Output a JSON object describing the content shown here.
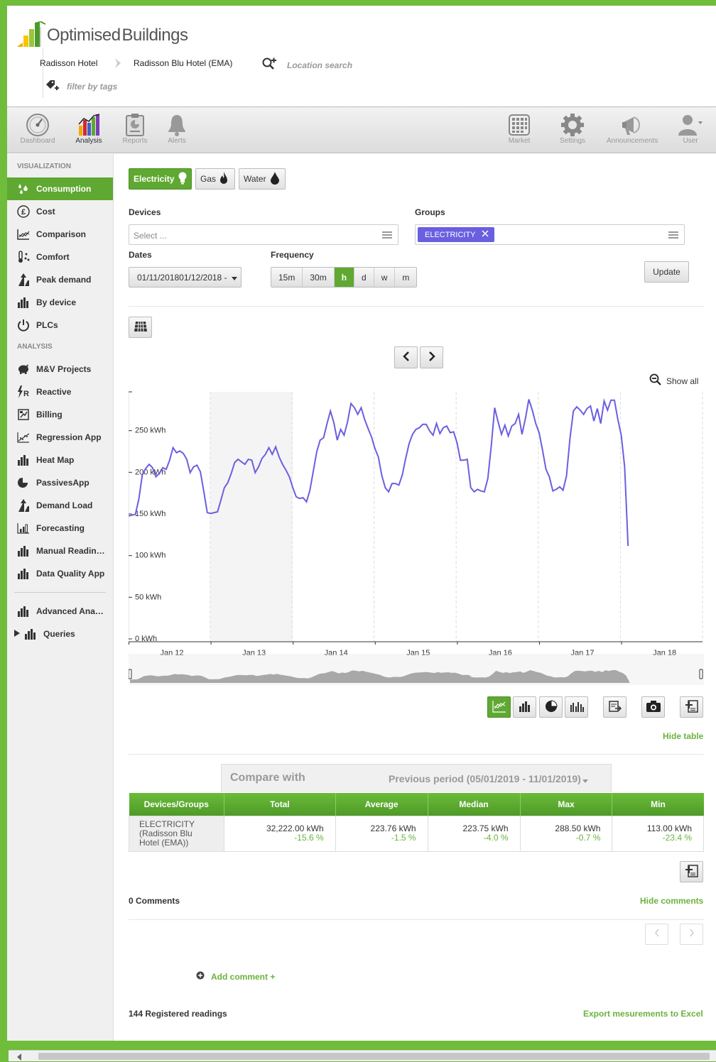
{
  "header": {
    "brand_first": "Optimised",
    "brand_second": "Buildings",
    "breadcrumb": [
      "Radisson Hotel",
      "Radisson Blu Hotel (EMA)"
    ],
    "search_placeholder": "Location search",
    "tags_placeholder": "filter by tags"
  },
  "toolbar": {
    "left": [
      {
        "label": "Dashboard",
        "icon": "speedometer-icon"
      },
      {
        "label": "Analysis",
        "icon": "bar-chart-icon"
      },
      {
        "label": "Reports",
        "icon": "report-icon"
      },
      {
        "label": "Alerts",
        "icon": "bell-icon"
      }
    ],
    "right": [
      {
        "label": "Market",
        "icon": "grid-icon"
      },
      {
        "label": "Settings",
        "icon": "gear-icon"
      },
      {
        "label": "Announcements",
        "icon": "megaphone-icon"
      },
      {
        "label": "User",
        "icon": "user-icon"
      }
    ]
  },
  "sidebar": {
    "visualization_title": "VISUALIZATION",
    "visualization": [
      "Consumption",
      "Cost",
      "Comparison",
      "Comfort",
      "Peak demand",
      "By device",
      "PLCs"
    ],
    "analysis_title": "ANALYSIS",
    "analysis": [
      "M&V Projects",
      "Reactive",
      "Billing",
      "Regression App",
      "Heat Map",
      "PassivesApp",
      "Demand Load",
      "Forecasting",
      "Manual Readin…",
      "Data Quality App"
    ],
    "extra": [
      "Advanced Ana…",
      "Queries"
    ]
  },
  "filters": {
    "utilities": [
      "Electricity",
      "Gas",
      "Water"
    ],
    "devices_label": "Devices",
    "devices_placeholder": "Select ...",
    "groups_label": "Groups",
    "groups_chip": "ELECTRICITY",
    "dates_label": "Dates",
    "dates_value": "01/11/201801/12/2018 -",
    "frequency_label": "Frequency",
    "frequency_options": [
      "15m",
      "30m",
      "h",
      "d",
      "w",
      "m"
    ],
    "frequency_selected": "h",
    "update_label": "Update"
  },
  "show_all_label": "Show all",
  "chart_data": {
    "type": "line",
    "ylabel": "",
    "yunit": "kWh",
    "ylim": [
      0,
      300
    ],
    "yticks": [
      "0 kWh",
      "50 kWh",
      "100 kWh",
      "150 kWh",
      "200 kWh",
      "250 kWh"
    ],
    "xticks": [
      "Jan 12",
      "Jan 13",
      "Jan 14",
      "Jan 15",
      "Jan 16",
      "Jan 17",
      "Jan 18"
    ],
    "x_start_label": "Jan 12",
    "line_color": "#6a5fe0",
    "values": [
      151,
      152,
      153,
      171,
      200,
      208,
      213,
      209,
      198,
      202,
      209,
      207,
      218,
      233,
      227,
      229,
      226,
      219,
      203,
      210,
      212,
      204,
      180,
      155,
      154,
      155,
      156,
      170,
      185,
      191,
      202,
      215,
      219,
      216,
      213,
      219,
      218,
      203,
      210,
      220,
      225,
      233,
      225,
      234,
      222,
      213,
      206,
      198,
      185,
      174,
      172,
      173,
      168,
      182,
      205,
      228,
      242,
      245,
      262,
      277,
      263,
      242,
      255,
      248,
      264,
      286,
      281,
      273,
      281,
      267,
      256,
      246,
      232,
      222,
      200,
      185,
      180,
      190,
      190,
      188,
      200,
      220,
      238,
      249,
      255,
      257,
      261,
      261,
      253,
      248,
      262,
      250,
      257,
      259,
      251,
      252,
      239,
      218,
      218,
      219,
      185,
      180,
      183,
      181,
      180,
      196,
      235,
      281,
      264,
      249,
      260,
      247,
      259,
      262,
      273,
      249,
      268,
      291,
      278,
      262,
      251,
      230,
      207,
      198,
      181,
      183,
      186,
      182,
      199,
      244,
      277,
      282,
      278,
      273,
      280,
      283,
      265,
      280,
      262,
      289,
      278,
      290,
      290,
      267,
      248,
      210,
      115
    ]
  },
  "chart_tools": [
    "line-chart-icon",
    "bar-chart-icon",
    "pie-chart-icon",
    "grouped-bar-icon",
    "export-icon",
    "camera-icon",
    "add-note-icon"
  ],
  "hide_table_label": "Hide table",
  "compare": {
    "label": "Compare with",
    "value": "Previous period (05/01/2019 - 11/01/2019)"
  },
  "table": {
    "headers": [
      "Devices/Groups",
      "Total",
      "Average",
      "Median",
      "Max",
      "Min"
    ],
    "row_name_lines": [
      "ELECTRICITY",
      "(Radisson Blu",
      "Hotel (EMA))"
    ],
    "cells": [
      {
        "value": "32,222.00 kWh",
        "pct": "-15.6 %"
      },
      {
        "value": "223.76 kWh",
        "pct": "-1.5 %"
      },
      {
        "value": "223.75 kWh",
        "pct": "-4.0 %"
      },
      {
        "value": "288.50 kWh",
        "pct": "-0.7 %"
      },
      {
        "value": "113.00 kWh",
        "pct": "-23.4 %"
      }
    ]
  },
  "comments": {
    "count_label": "0 Comments",
    "hide_label": "Hide comments",
    "add_label": "Add comment +"
  },
  "footer": {
    "readings_label": "144 Registered readings",
    "export_label": "Export mesurements to Excel"
  }
}
